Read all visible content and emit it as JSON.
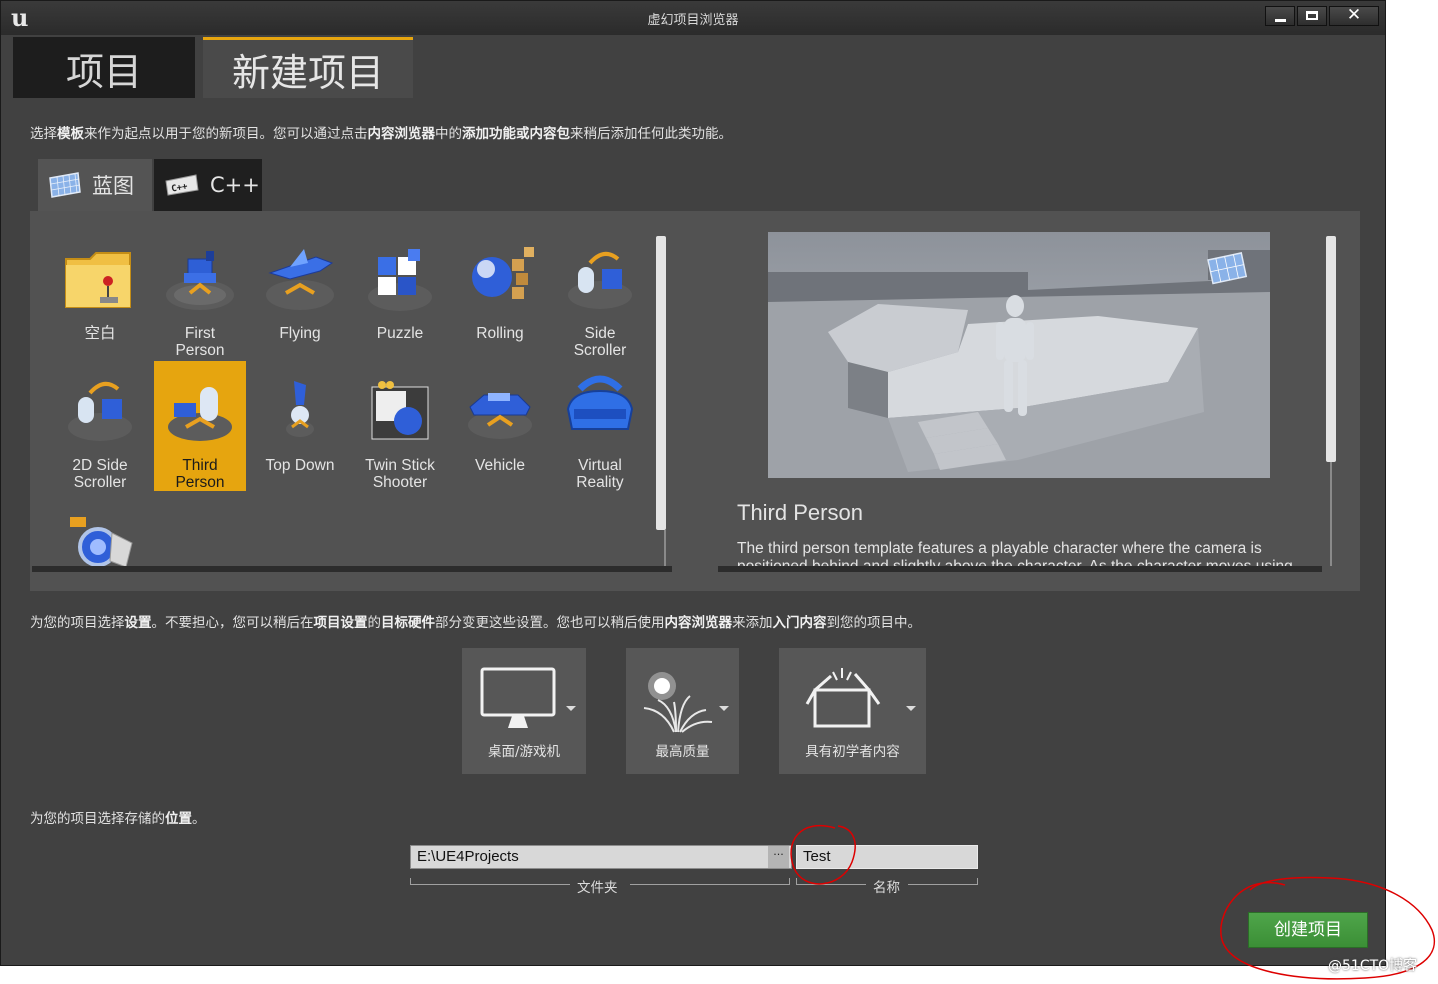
{
  "window": {
    "title": "虚幻项目浏览器"
  },
  "main_tabs": [
    {
      "label": "项目"
    },
    {
      "label": "新建项目"
    }
  ],
  "template_hint": {
    "p1": "选择",
    "b1": "模板",
    "p2": "来作为起点以用于您的新项目。您可以通过点击",
    "b2": "内容浏览器",
    "p3": "中的",
    "b3": "添加功能或内容包",
    "p4": "来稍后添加任何此类功能。"
  },
  "template_tabs": [
    {
      "label": "蓝图",
      "icon": "blueprint-icon"
    },
    {
      "label": "C++",
      "icon": "cpp-icon"
    }
  ],
  "templates": [
    {
      "name": "空白",
      "icon": "blank-folder-icon"
    },
    {
      "name": "First\nPerson",
      "icon": "first-person-icon"
    },
    {
      "name": "Flying",
      "icon": "flying-icon"
    },
    {
      "name": "Puzzle",
      "icon": "puzzle-icon"
    },
    {
      "name": "Rolling",
      "icon": "rolling-icon"
    },
    {
      "name": "Side\nScroller",
      "icon": "side-scroller-icon"
    },
    {
      "name": "2D Side\nScroller",
      "icon": "2d-side-scroller-icon"
    },
    {
      "name": "Third\nPerson",
      "icon": "third-person-icon",
      "selected": true
    },
    {
      "name": "Top Down",
      "icon": "top-down-icon"
    },
    {
      "name": "Twin Stick\nShooter",
      "icon": "twin-stick-icon"
    },
    {
      "name": "Vehicle",
      "icon": "vehicle-icon"
    },
    {
      "name": "Virtual\nReality",
      "icon": "vr-headset-icon"
    },
    {
      "name": "",
      "icon": "vehicle-advanced-icon"
    }
  ],
  "preview": {
    "title": "Third Person",
    "description": "The third person template features a playable character where the camera is positioned behind and slightly above the character. As the character moves using"
  },
  "settings_hint": {
    "p1": "为您的项目选择",
    "b1": "设置",
    "p2": "。不要担心，您可以稍后在",
    "b2": "项目设置",
    "p3": "的",
    "b3": "目标硬件",
    "p4": "部分变更这些设置。您也可以稍后使用",
    "b4": "内容浏览器",
    "p5": "来添加",
    "b5": "入门内容",
    "p6": "到您的项目中。"
  },
  "settings": [
    {
      "label": "桌面/游戏机",
      "icon": "monitor-icon"
    },
    {
      "label": "最高质量",
      "icon": "quality-icon"
    },
    {
      "label": "具有初学者内容",
      "icon": "starter-box-icon"
    }
  ],
  "location_hint": {
    "p1": "为您的项目选择存储的",
    "b1": "位置",
    "p2": "。"
  },
  "location": {
    "folder_value": "E:\\UE4Projects",
    "browse_label": "···",
    "folder_label": "文件夹",
    "name_value": "Test",
    "name_label": "名称"
  },
  "create_button": {
    "label": "创建项目"
  },
  "watermark": "@51CTO博客",
  "colors": {
    "accent": "#e6a50f",
    "create_green": "#46a042",
    "annotation_red": "#dd0000"
  }
}
